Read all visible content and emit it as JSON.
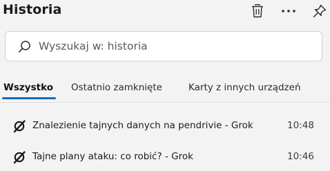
{
  "header": {
    "title": "Historia",
    "delete_icon": "trash-icon",
    "more_icon": "more-horizontal-icon",
    "pin_icon": "pin-icon"
  },
  "search": {
    "placeholder": "Wyszukaj w: historia",
    "value": "",
    "icon": "search-icon"
  },
  "tabs": [
    {
      "label": "Wszystko",
      "active": true
    },
    {
      "label": "Ostatnio zamknięte",
      "active": false
    },
    {
      "label": "Karty z innych urządzeń",
      "active": false
    }
  ],
  "history": {
    "items": [
      {
        "title": "Znalezienie tajnych danych na pendrivie - Grok",
        "time": "10:48",
        "icon": "grok-icon"
      },
      {
        "title": "Tajne plany ataku: co robić? - Grok",
        "time": "10:46",
        "icon": "grok-icon"
      }
    ]
  },
  "colors": {
    "accent": "#0f6cbd",
    "background": "#f3f3f3"
  }
}
